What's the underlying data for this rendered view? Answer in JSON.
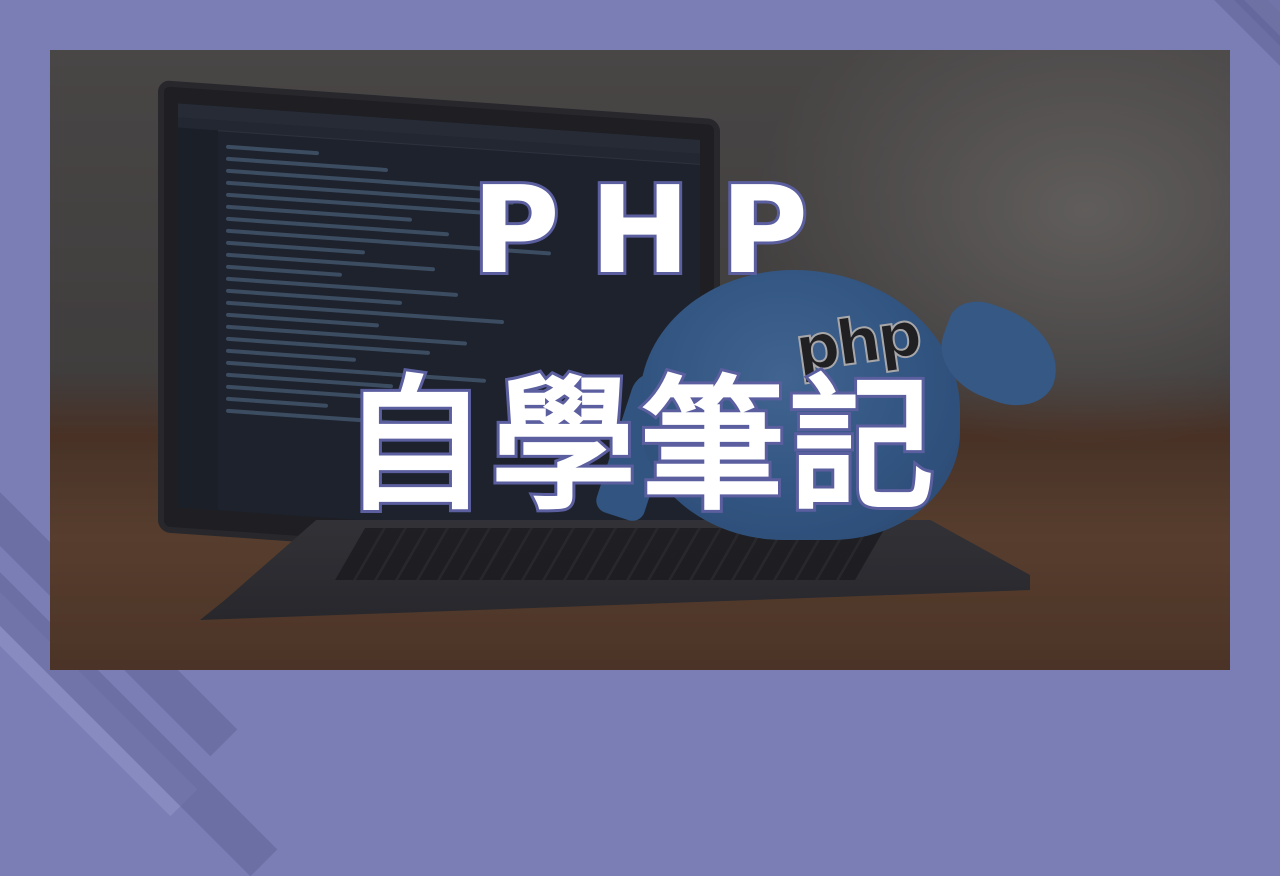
{
  "banner": {
    "title_line_1": "PHP",
    "title_line_2": "自學筆記",
    "toy_logo": "php"
  },
  "colors": {
    "background": "#7a7eb5",
    "text_fill": "#ffffff",
    "text_outline": "#5b5f9f"
  }
}
